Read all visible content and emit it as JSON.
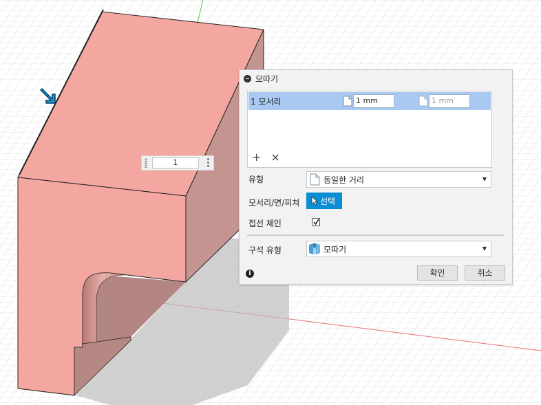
{
  "dialog": {
    "title": "모따기",
    "edge_list": {
      "row_label": "1 모서리",
      "distance_1": "1 mm",
      "distance_2": "1 mm",
      "add_icon": "plus-icon",
      "remove_icon": "x-icon"
    },
    "type_label": "유형",
    "type_value": "동일한 거리",
    "edges_label": "모서리/면/피쳐",
    "select_label": "선택",
    "tangent_chain_label": "접선 체인",
    "tangent_chain_checked": true,
    "corner_type_label": "구석 유형",
    "corner_type_value": "모따기",
    "ok_label": "확인",
    "cancel_label": "취소",
    "accent_color": "#0b8ed3",
    "selection_color": "#a9c9f2"
  },
  "viewport": {
    "float_input_value": "1",
    "model_color": "#f4a7a0",
    "edge_arrow_color": "#1a9ad6"
  }
}
